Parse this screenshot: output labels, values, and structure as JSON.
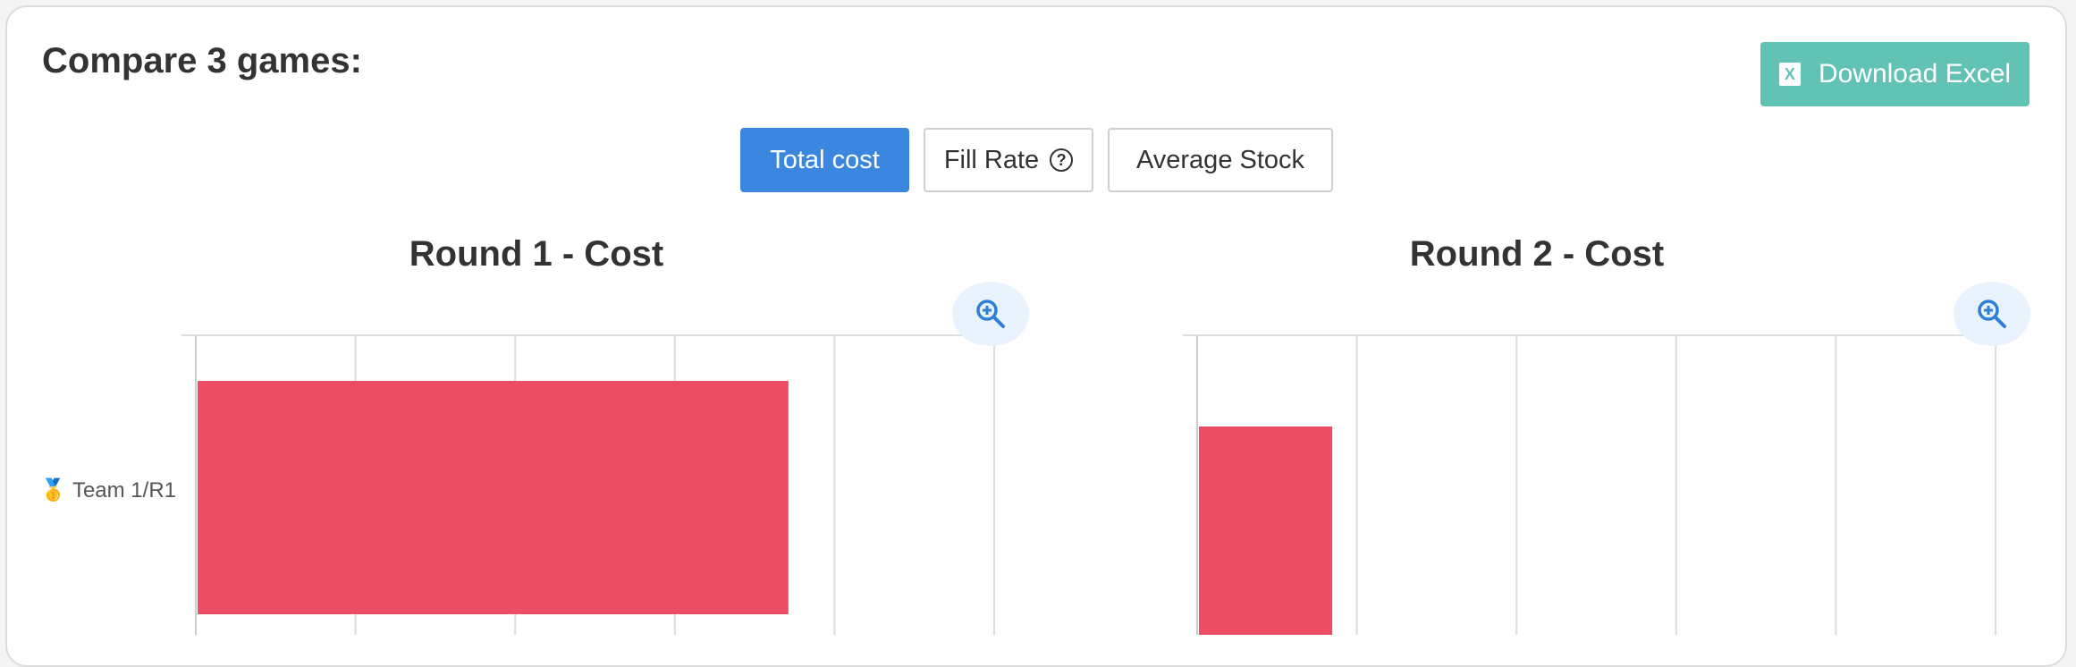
{
  "header": {
    "title": "Compare 3 games:",
    "download_label": "Download Excel",
    "download_icon": "X"
  },
  "tabs": [
    {
      "label": "Total cost",
      "active": true
    },
    {
      "label": "Fill Rate",
      "active": false,
      "icon": "?"
    },
    {
      "label": "Average Stock",
      "active": false
    }
  ],
  "colors": {
    "accent": "#3b87e0",
    "excel": "#62c2b4",
    "bar": "#eb4d64"
  },
  "chart_data": [
    {
      "type": "bar",
      "orientation": "horizontal",
      "title": "Round 1 - Cost",
      "categories": [
        "🥇 Team 1/R1"
      ],
      "values": [
        0.74
      ],
      "xlim": [
        0,
        1
      ],
      "x_gridlines": 5,
      "grid": true
    },
    {
      "type": "bar",
      "orientation": "horizontal",
      "title": "Round 2 - Cost",
      "categories": [],
      "values": [
        0.167
      ],
      "xlim": [
        0,
        1
      ],
      "x_gridlines": 5,
      "grid": true
    }
  ]
}
